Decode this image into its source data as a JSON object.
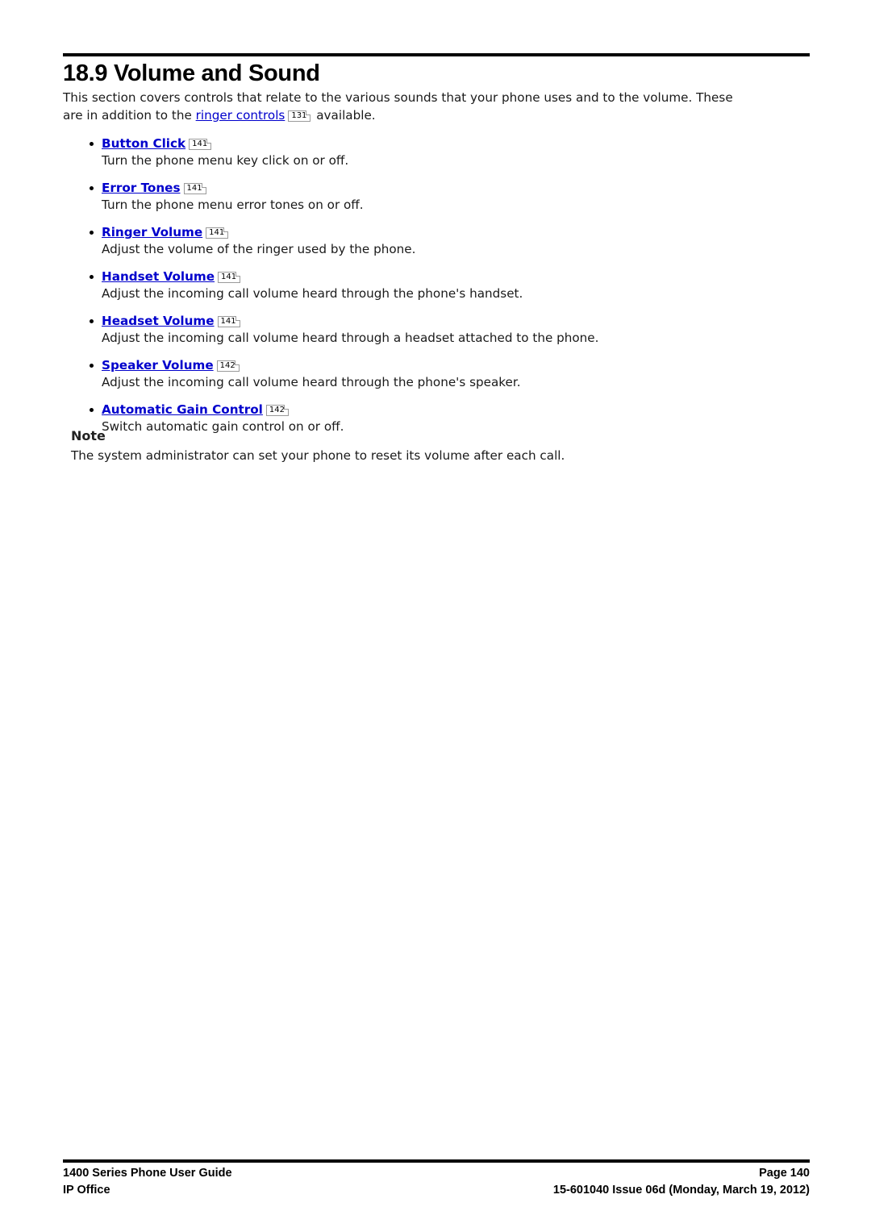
{
  "document": {
    "section_number_title": "18.9 Volume and Sound"
  },
  "intro": {
    "part1": "This section covers controls that relate to the various sounds that your phone uses and to the volume. These are in addition to the ",
    "link_text": "ringer controls",
    "link_page_ref": "131",
    "part2": " available."
  },
  "bullets": [
    {
      "title": "Button Click",
      "page_ref": "141",
      "description": "Turn the phone menu key click on or off."
    },
    {
      "title": "Error Tones",
      "page_ref": "141",
      "description": "Turn the phone menu error tones on or off."
    },
    {
      "title": "Ringer Volume",
      "page_ref": "141",
      "description": "Adjust the volume of the ringer used by the phone."
    },
    {
      "title": "Handset Volume",
      "page_ref": "141",
      "description": "Adjust the incoming call volume heard through the phone's handset."
    },
    {
      "title": "Headset Volume",
      "page_ref": "141",
      "description": "Adjust the incoming call volume heard through a headset attached to the phone."
    },
    {
      "title": "Speaker Volume",
      "page_ref": "142",
      "description": "Adjust the incoming call volume heard through the phone's speaker."
    },
    {
      "title": "Automatic Gain Control",
      "page_ref": "142",
      "description": "Switch automatic gain control on or off."
    }
  ],
  "note": {
    "title": "Note",
    "text": "The system administrator can set your phone to reset its volume after each call."
  },
  "footer": {
    "left_line1": "1400 Series Phone User Guide",
    "left_line2": "IP Office",
    "right_line1": "Page 140",
    "right_line2": "15-601040 Issue 06d (Monday, March 19, 2012)"
  },
  "colors": {
    "link": "#0000cc",
    "text": "#1a1a1a",
    "rule": "#000000",
    "badge_border": "#9a9a9a"
  }
}
